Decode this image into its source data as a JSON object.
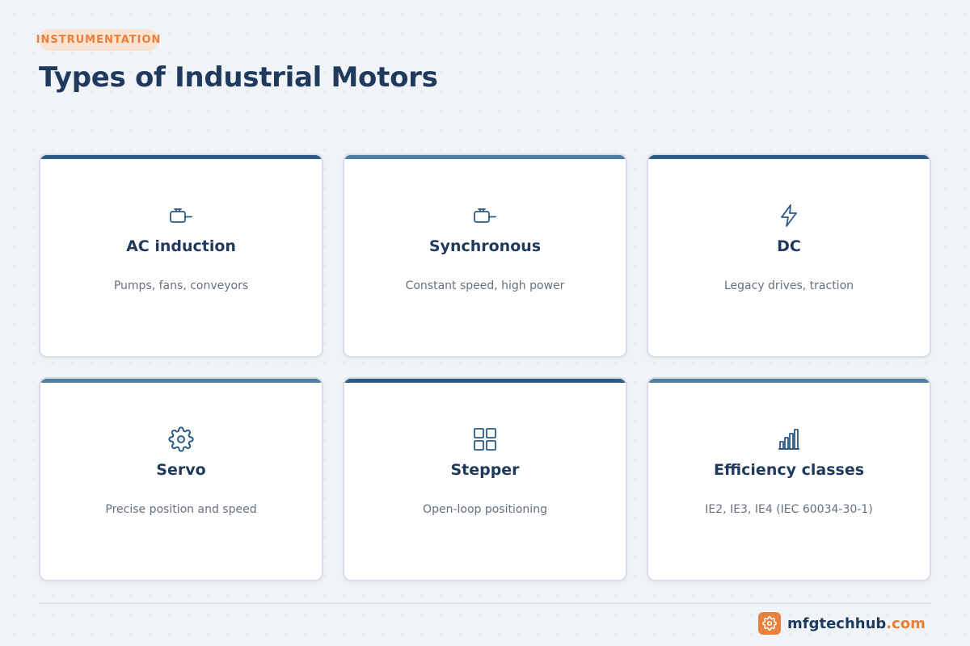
{
  "header": {
    "badge": "INSTRUMENTATION",
    "title": "Types of Industrial Motors"
  },
  "cards": [
    {
      "title": "AC induction",
      "description": "Pumps, fans, conveyors",
      "icon": "motor-icon",
      "accent": "#2c5a85"
    },
    {
      "title": "Synchronous",
      "description": "Constant speed, high power",
      "icon": "motor-icon",
      "accent": "#4f7fa3"
    },
    {
      "title": "DC",
      "description": "Legacy drives, traction",
      "icon": "lightning-icon",
      "accent": "#2c5a85"
    },
    {
      "title": "Servo",
      "description": "Precise position and speed",
      "icon": "gear-icon",
      "accent": "#4f7fa3"
    },
    {
      "title": "Stepper",
      "description": "Open-loop positioning",
      "icon": "grid-icon",
      "accent": "#2c5a85"
    },
    {
      "title": "Efficiency classes",
      "description": "IE2, IE3, IE4 (IEC 60034-30-1)",
      "icon": "bar-chart-icon",
      "accent": "#4f7fa3"
    }
  ],
  "footer": {
    "brand_name": "mfgtechhub",
    "brand_domain": ".com",
    "brand_icon": "gear-icon"
  },
  "colors": {
    "primary": "#1f3a5c",
    "accent_orange": "#e7803d",
    "card_border": "#d7dde5",
    "background": "#f0f3f7"
  }
}
